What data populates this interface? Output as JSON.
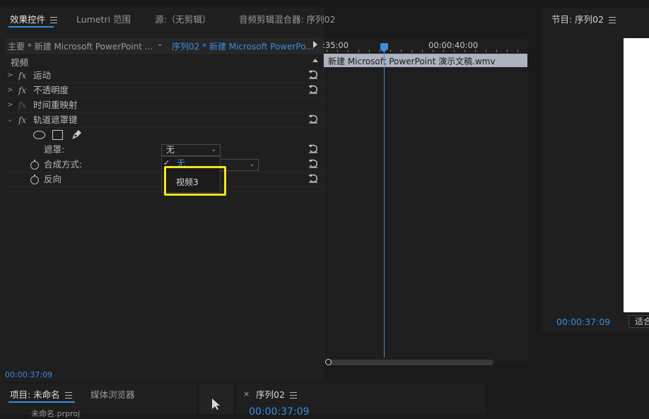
{
  "effect_controls": {
    "tabs": [
      {
        "label": "效果控件",
        "active": true
      },
      {
        "label": "Lumetri 范围"
      },
      {
        "label": "源:（无剪辑）"
      },
      {
        "label": "音频剪辑混合器: 序列02"
      }
    ],
    "clip_master": "主要 * 新建 Microsoft PowerPoint ...",
    "clip_sequence": "序列02 * 新建 Microsoft PowerPo...",
    "section_video": "视频",
    "effects": [
      {
        "label": "运动"
      },
      {
        "label": "不透明度"
      },
      {
        "label": "时间重映射"
      },
      {
        "label": "轨道遮罩键"
      }
    ],
    "mask_label": "遮罩:",
    "mask_value": "无",
    "composite_label": "合成方式:",
    "reverse_label": "反向",
    "menu_items": [
      "无",
      "视频3"
    ],
    "current_time": "00:00:37:09"
  },
  "mini_timeline": {
    "ruler_left": ":35:00",
    "ruler_right": "00:00:40:00",
    "clip_name": "新建 Microsoft PowerPoint 演示文稿.wmv"
  },
  "program": {
    "title": "节目: 序列02",
    "timecode": "00:00:37:09",
    "fit_label": "适合"
  },
  "project": {
    "tab_active": "项目: 未命名",
    "tab_media": "媒体浏览器",
    "item_partial": "未命名.prproj"
  },
  "timeline": {
    "close": "×",
    "title": "序列02",
    "timecode": "00:00:37:09"
  },
  "colors": {
    "accent": "#3a8ee0",
    "highlight": "#f2e41b"
  }
}
